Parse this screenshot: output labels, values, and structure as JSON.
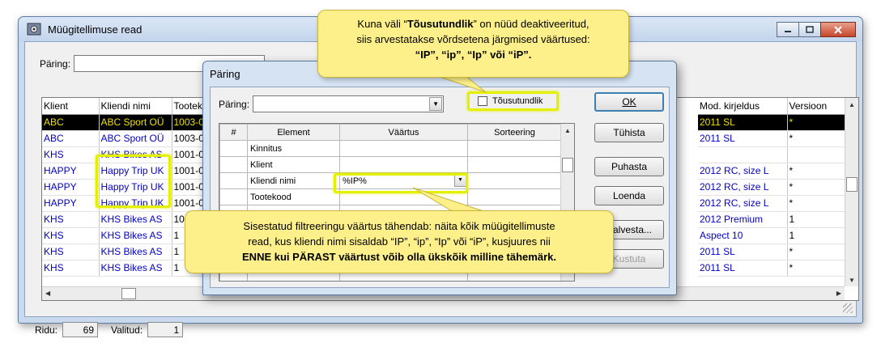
{
  "main_window": {
    "title": "Müügitellimuse read",
    "paring_label": "Päring:",
    "columns_left": [
      "Klient",
      "Kliendi nimi",
      "Tootek"
    ],
    "rows_left": [
      [
        "ABC",
        "ABC Sport OÜ",
        "1003-0"
      ],
      [
        "ABC",
        "ABC Sport OÜ",
        "1003-0"
      ],
      [
        "KHS",
        "KHS Bikes AS",
        "1001-0"
      ],
      [
        "HAPPY",
        "Happy Trip UK",
        "1001-0"
      ],
      [
        "HAPPY",
        "Happy Trip UK",
        "1001-0"
      ],
      [
        "HAPPY",
        "Happy Trip UK",
        "1001-0"
      ],
      [
        "KHS",
        "KHS Bikes AS",
        "1001-0"
      ],
      [
        "KHS",
        "KHS Bikes AS",
        "1"
      ],
      [
        "KHS",
        "KHS Bikes AS",
        "1"
      ],
      [
        "KHS",
        "KHS Bikes AS",
        "1"
      ]
    ],
    "columns_right": [
      "Mod. kirjeldus",
      "Versioon"
    ],
    "rows_right": [
      [
        "2011 SL",
        "*"
      ],
      [
        "2011 SL",
        "*"
      ],
      [
        "",
        ""
      ],
      [
        "2012 RC, size L",
        "*"
      ],
      [
        "2012 RC, size L",
        "*"
      ],
      [
        "2012 RC, size L",
        "*"
      ],
      [
        "2012 Premium",
        "1"
      ],
      [
        "Aspect 10",
        "1"
      ],
      [
        "2011 SL",
        "*"
      ],
      [
        "2011 SL",
        "*"
      ]
    ],
    "status_rows_label": "Ridu:",
    "status_rows_value": "69",
    "status_selected_label": "Valitud:",
    "status_selected_value": "1"
  },
  "dialog": {
    "title": "Päring",
    "paring_label": "Päring:",
    "checkbox_label": "Tõusutundlik",
    "columns": [
      "#",
      "Element",
      "Väärtus",
      "Sorteering"
    ],
    "rows": [
      [
        "",
        "Kinnitus",
        "",
        ""
      ],
      [
        "",
        "Klient",
        "",
        ""
      ],
      [
        "",
        "Kliendi nimi",
        "%IP%",
        ""
      ],
      [
        "",
        "Tootekood",
        "",
        ""
      ]
    ],
    "buttons": {
      "ok": "OK",
      "cancel": "Tühista",
      "clear": "Puhasta",
      "list": "Loenda",
      "save": "Salvesta...",
      "delete": "Kustuta"
    }
  },
  "callout_top": {
    "line1_a": "Kuna väli “",
    "line1_bold": "Tõusutundlik",
    "line1_b": "” on nüüd deaktiveeritud,",
    "line2": "siis arvestatakse võrdsetena järgmised väärtused:",
    "line3": "“IP”, “ip”, “Ip” või “iP”."
  },
  "callout_bottom": {
    "line1": "Sisestatud filtreeringu väärtus tähendab: näita kõik müügitellimuste",
    "line2": "read, kus kliendi nimi sisaldab “IP”, “ip”, “Ip” või “iP”, kusjuures nii",
    "line3": "ENNE kui PÄRAST väärtust võib olla ükskõik milline tähemärk."
  },
  "colors": {
    "highlight": "#e4f000",
    "callout_bg": "#fdf08a",
    "link_blue": "#0000c8",
    "selected_row_bg": "#000000",
    "selected_row_text": "#f0e000"
  }
}
